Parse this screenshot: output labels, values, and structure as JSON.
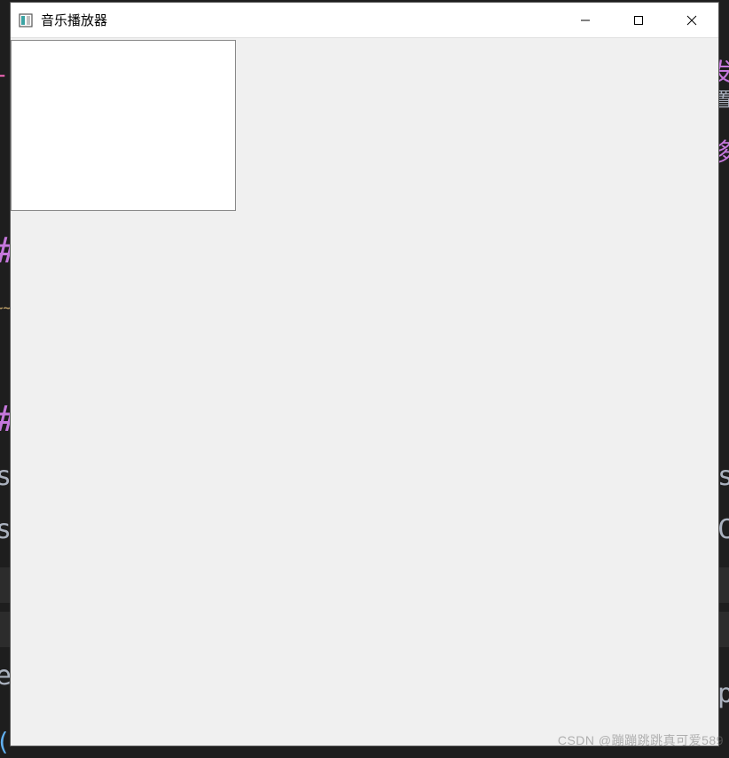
{
  "window": {
    "title": "音乐播放器"
  },
  "watermark": "CSDN @蹦蹦跳跳真可爱589"
}
